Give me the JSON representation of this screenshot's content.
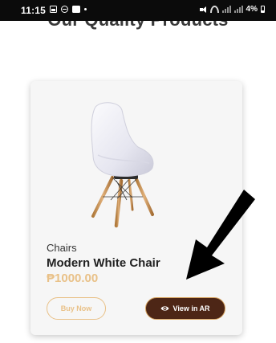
{
  "status_bar": {
    "time": "11:15",
    "left_icons": [
      "gallery-icon",
      "minus-circle-icon",
      "message-icon",
      "dot-icon"
    ],
    "right_icons": [
      "mute-icon",
      "wifi-icon",
      "signal-icon",
      "signal-icon"
    ],
    "battery": "4%"
  },
  "page": {
    "heading": "Our Quality Products"
  },
  "product": {
    "image_icon": "chair-image",
    "category": "Chairs",
    "name": "Modern White Chair",
    "price": "₱1000.00",
    "buy_label": "Buy Now",
    "ar_label": "View in AR",
    "ar_icon": "eye-icon"
  },
  "annotation": {
    "icon": "arrow-icon",
    "color": "#000000"
  },
  "colors": {
    "accent": "#e9c188",
    "ar_button_bg": "#4d2616",
    "heading": "#3a3a3a",
    "card_bg": "#f6f6f6"
  }
}
